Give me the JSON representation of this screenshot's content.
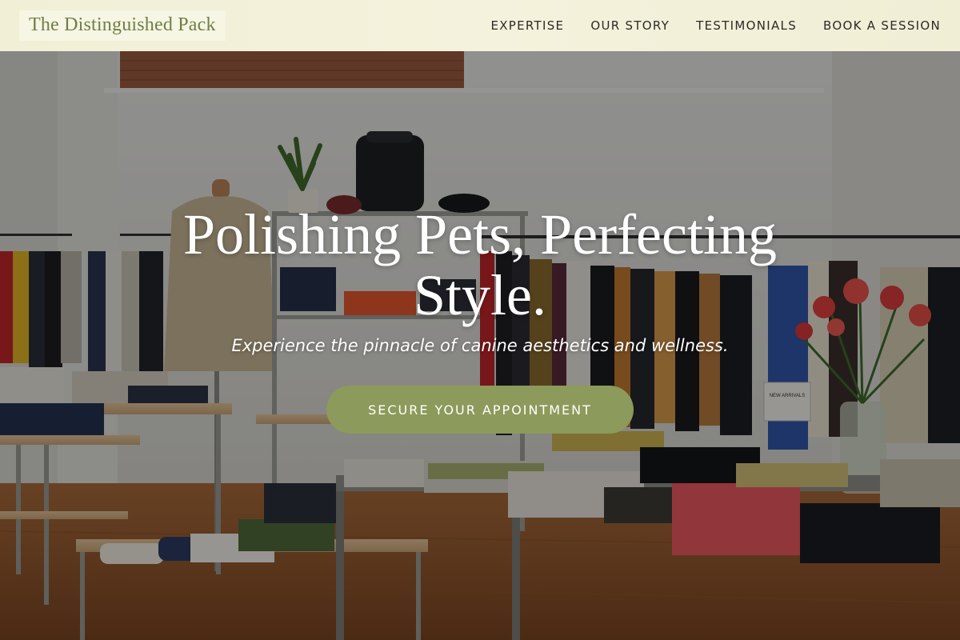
{
  "header": {
    "logo_text": "The Distinguished Pack",
    "nav": [
      {
        "label": "EXPERTISE"
      },
      {
        "label": "OUR STORY"
      },
      {
        "label": "TESTIMONIALS"
      },
      {
        "label": "BOOK A SESSION"
      }
    ]
  },
  "hero": {
    "title": "Polishing Pets, Perfecting Style.",
    "subtitle": "Experience the pinnacle of canine aesthetics and wellness.",
    "cta_label": "SECURE YOUR APPOINTMENT",
    "background_image": "boutique-store-interior",
    "sign_text": "NEW ARRIVALS"
  },
  "colors": {
    "header_bg": "#f2f0d8",
    "logo_text": "#6f7f44",
    "nav_text": "#2b2b27",
    "cta_bg": "#8c9a5b",
    "hero_text": "#ffffff"
  }
}
